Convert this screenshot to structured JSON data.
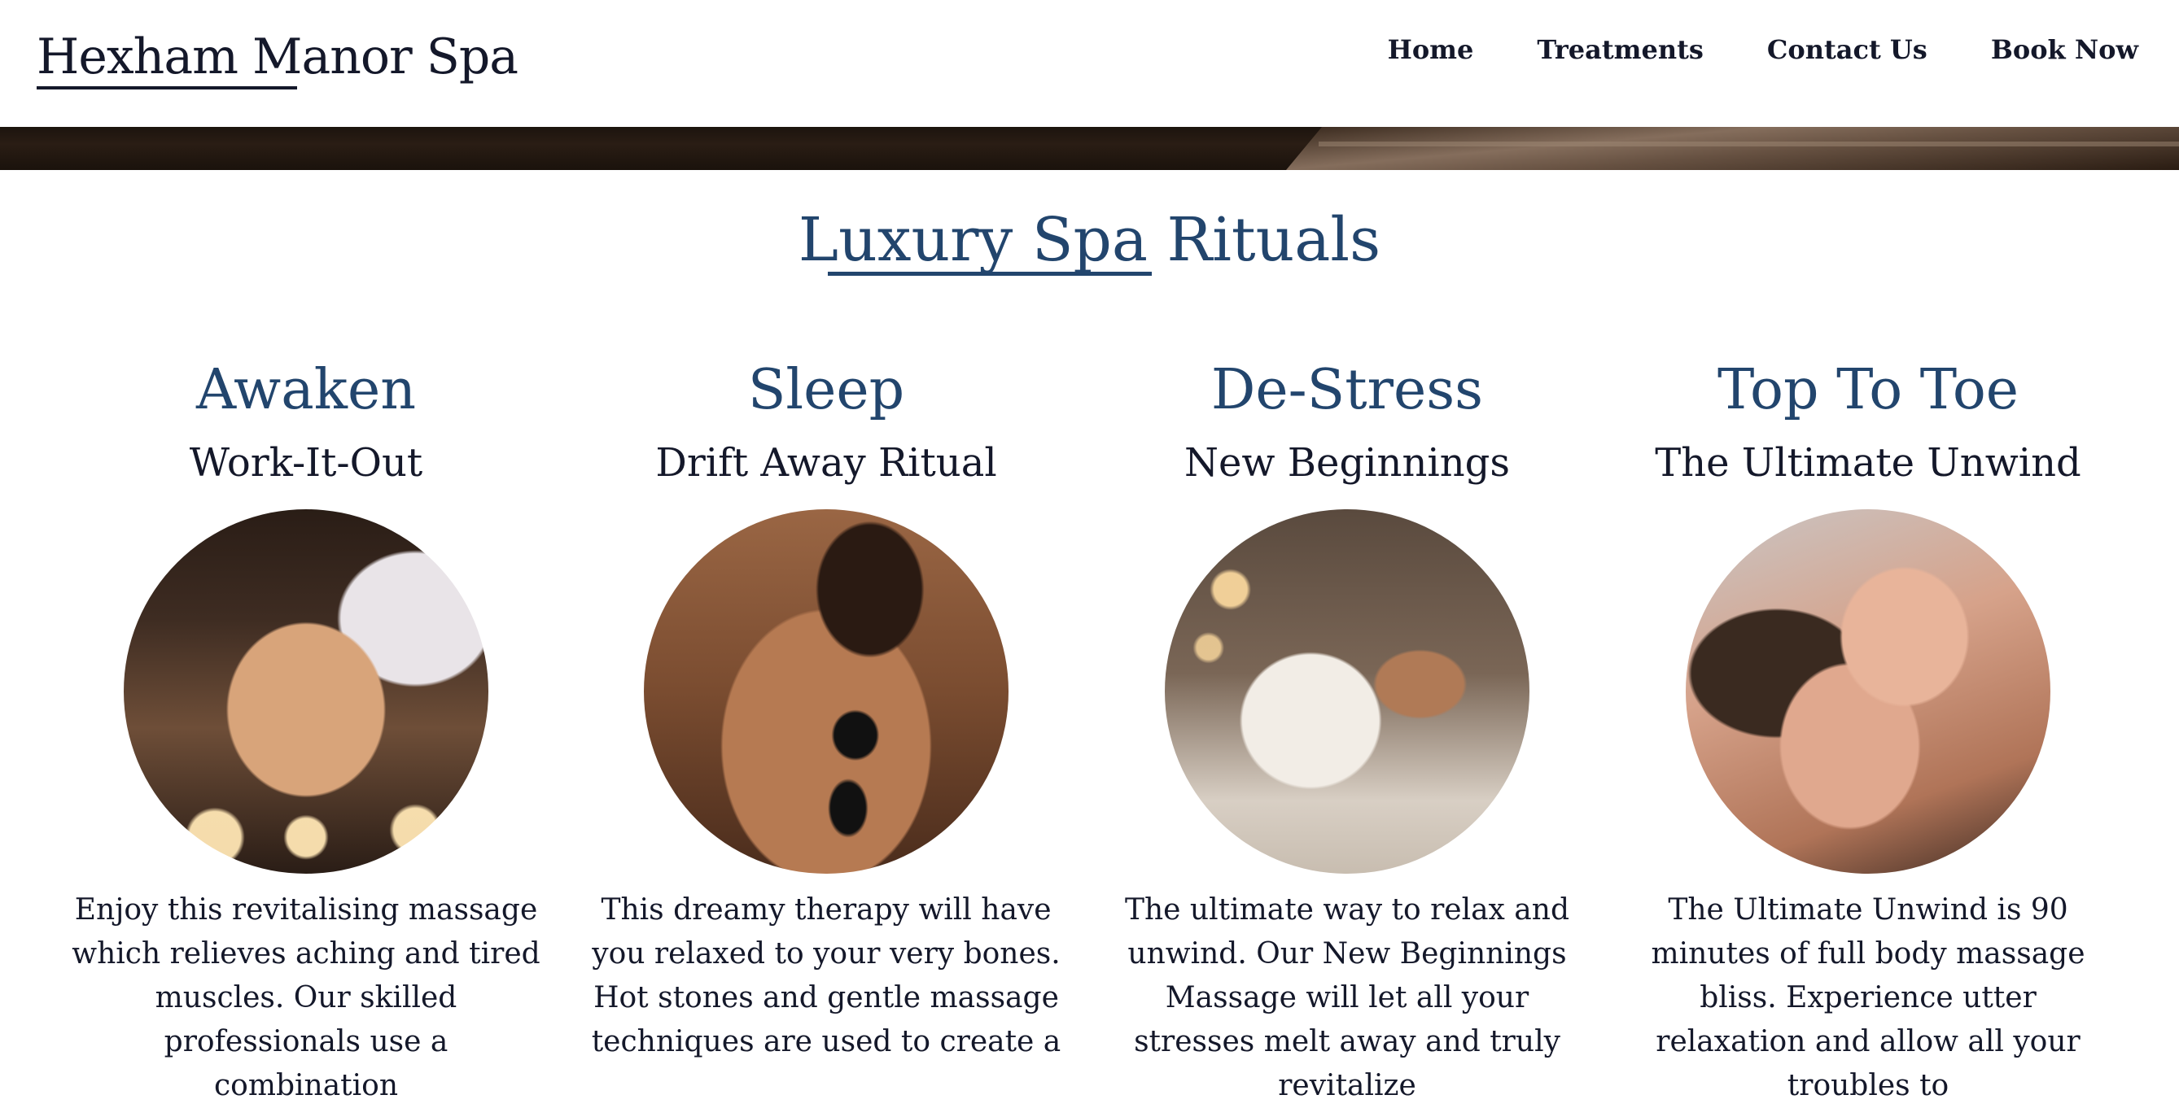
{
  "header": {
    "site_title": "Hexham Manor Spa",
    "nav": [
      {
        "label": "Home"
      },
      {
        "label": "Treatments"
      },
      {
        "label": "Contact Us"
      },
      {
        "label": "Book Now"
      }
    ]
  },
  "main": {
    "section_title": "Luxury Spa Rituals",
    "cards": [
      {
        "category": "Awaken",
        "name": "Work-It-Out",
        "description": "Enjoy this revitalising massage which relieves aching and tired muscles. Our skilled professionals use a combination"
      },
      {
        "category": "Sleep",
        "name": "Drift Away Ritual",
        "description": "This dreamy therapy will have you relaxed to your very bones. Hot stones and gentle massage techniques are used to create a"
      },
      {
        "category": "De-Stress",
        "name": "New Beginnings",
        "description": "The ultimate way to relax and unwind. Our New Beginnings Massage will let all your stresses melt away and truly revitalize"
      },
      {
        "category": "Top To Toe",
        "name": "The Ultimate Unwind",
        "description": "The Ultimate Unwind is 90 minutes of full body massage bliss. Experience utter relaxation and allow all your troubles to"
      }
    ]
  },
  "colors": {
    "accent": "#22456d",
    "text": "#14182a",
    "background": "#ffffff"
  }
}
